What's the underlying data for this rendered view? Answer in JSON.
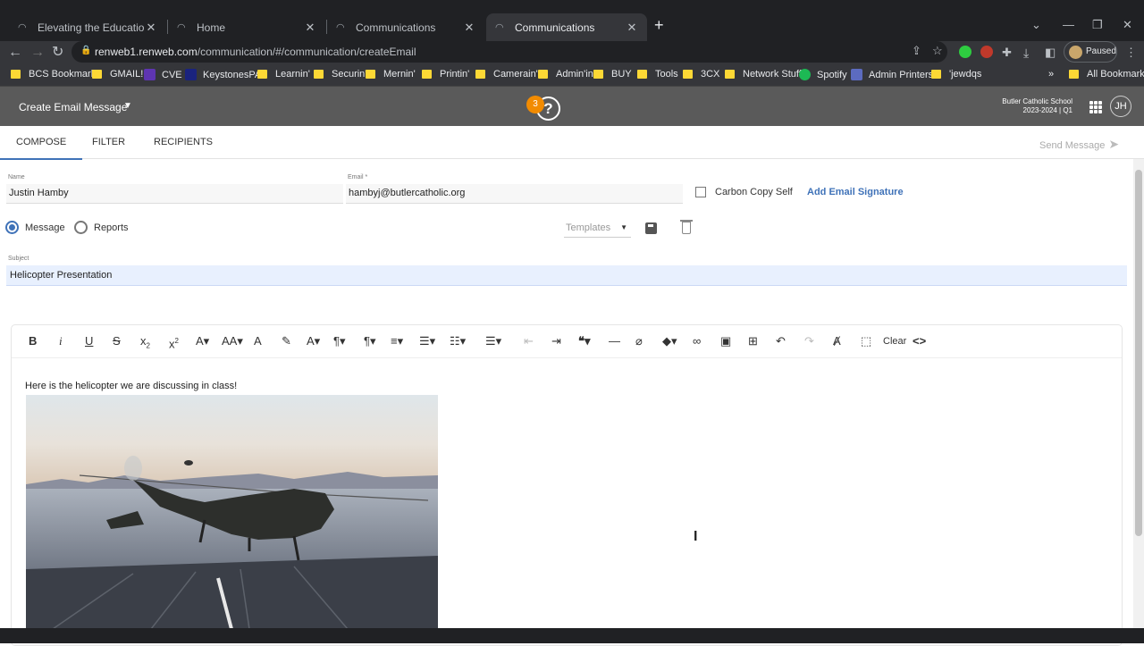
{
  "browser": {
    "tabs": [
      {
        "title": "Elevating the Education Experien",
        "active": false
      },
      {
        "title": "Home",
        "active": false
      },
      {
        "title": "Communications",
        "active": false
      },
      {
        "title": "Communications",
        "active": true
      }
    ],
    "url_domain": "renweb1.renweb.com",
    "url_path": "/communication/#/communication/createEmail",
    "profile_status": "Paused",
    "bookmarks": [
      "BCS Bookmarks",
      "GMAIL!",
      "CVE",
      "KeystonesPA",
      "Learnin'",
      "Securin'",
      "Mernin'",
      "Printin'",
      "Camerain'",
      "Admin'in",
      "BUY",
      "Tools",
      "3CX",
      "Network Stuff",
      "Spotify",
      "Admin Printers",
      "'jewdqs"
    ],
    "bookmarks_overflow": "»",
    "all_bookmarks": "All Bookmarks"
  },
  "app": {
    "title": "Create Email Message",
    "notification_count": "3",
    "help_glyph": "?",
    "school_name": "Butler Catholic School",
    "school_term": "2023-2024 | Q1",
    "user_initials": "JH"
  },
  "compose_tabs": [
    "COMPOSE",
    "FILTER",
    "RECIPIENTS"
  ],
  "send_label": "Send Message",
  "form": {
    "name_label": "Name",
    "name_value": "Justin Hamby",
    "email_label": "Email *",
    "email_value": "hambyj@butlercatholic.org",
    "cc_self_label": "Carbon Copy Self",
    "cc_self_checked": false,
    "add_signature_label": "Add Email Signature",
    "type_options": [
      "Message",
      "Reports"
    ],
    "type_selected": "Message",
    "templates_label": "Templates",
    "subject_label": "Subject",
    "subject_value": "Helicopter Presentation"
  },
  "editor": {
    "clear_label": "Clear",
    "body_text": "Here is the helicopter we are discussing in class!"
  },
  "colors": {
    "accent": "#3f72b8",
    "appbar": "#5a5a5a",
    "badge": "#f28b00"
  }
}
